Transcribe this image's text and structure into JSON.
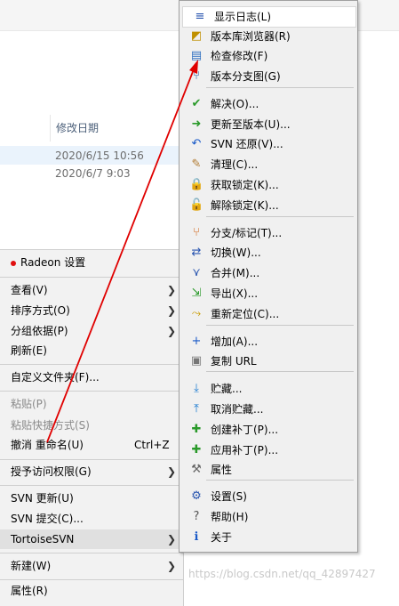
{
  "explorer": {
    "column_date": "修改日期",
    "dates": [
      "2020/6/15 10:56",
      "2020/6/7 9:03"
    ]
  },
  "context_menu": {
    "radeon": "Radeon 设置",
    "view": "查看(V)",
    "sort_by": "排序方式(O)",
    "group_by": "分组依据(P)",
    "refresh": "刷新(E)",
    "customize_folder": "自定义文件夹(F)...",
    "paste": "粘贴(P)",
    "paste_shortcut": "粘贴快捷方式(S)",
    "undo_rename": "撤消 重命名(U)",
    "undo_shortcut": "Ctrl+Z",
    "grant_access": "授予访问权限(G)",
    "svn_update": "SVN 更新(U)",
    "svn_commit": "SVN 提交(C)...",
    "tortoisesvn": "TortoiseSVN",
    "new": "新建(W)",
    "properties": "属性(R)"
  },
  "svn_menu": {
    "items": [
      {
        "label": "显示日志(L)",
        "icon": "show-log-icon"
      },
      {
        "label": "版本库浏览器(R)",
        "icon": "repo-browser-icon"
      },
      {
        "label": "检查修改(F)",
        "icon": "check-modifications-icon"
      },
      {
        "label": "版本分支图(G)",
        "icon": "revision-graph-icon"
      },
      {
        "label": "解决(O)...",
        "icon": "resolve-icon"
      },
      {
        "label": "更新至版本(U)...",
        "icon": "update-to-revision-icon"
      },
      {
        "label": "SVN 还原(V)...",
        "icon": "revert-icon"
      },
      {
        "label": "清理(C)...",
        "icon": "cleanup-icon"
      },
      {
        "label": "获取锁定(K)...",
        "icon": "get-lock-icon"
      },
      {
        "label": "解除锁定(K)...",
        "icon": "release-lock-icon"
      },
      {
        "label": "分支/标记(T)...",
        "icon": "branch-tag-icon"
      },
      {
        "label": "切换(W)...",
        "icon": "switch-icon"
      },
      {
        "label": "合并(M)...",
        "icon": "merge-icon"
      },
      {
        "label": "导出(X)...",
        "icon": "export-icon"
      },
      {
        "label": "重新定位(C)...",
        "icon": "relocate-icon"
      },
      {
        "label": "增加(A)...",
        "icon": "add-icon"
      },
      {
        "label": "复制 URL",
        "icon": "copy-url-icon"
      },
      {
        "label": "贮藏...",
        "icon": "shelve-icon"
      },
      {
        "label": "取消贮藏...",
        "icon": "unshelve-icon"
      },
      {
        "label": "创建补丁(P)...",
        "icon": "create-patch-icon"
      },
      {
        "label": "应用补丁(P)...",
        "icon": "apply-patch-icon"
      },
      {
        "label": "属性",
        "icon": "properties-icon"
      },
      {
        "label": "设置(S)",
        "icon": "settings-icon"
      },
      {
        "label": "帮助(H)",
        "icon": "help-icon"
      },
      {
        "label": "关于",
        "icon": "about-icon"
      }
    ]
  },
  "watermark": "https://blog.csdn.net/qq_42897427",
  "colors": {
    "annotation_arrow": "#e00000",
    "hover_bg": "#ffffff",
    "menu_bg": "#f0f0f0"
  }
}
